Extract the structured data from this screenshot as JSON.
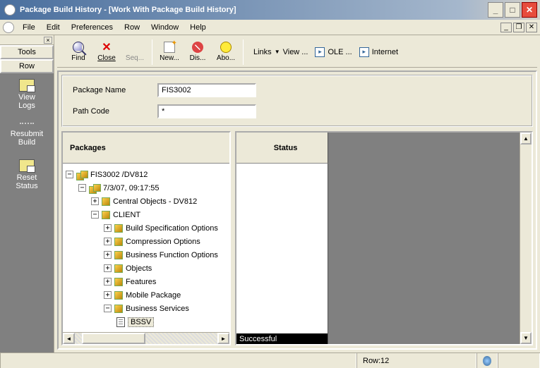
{
  "window": {
    "title": "Package Build History - [Work With Package Build History]"
  },
  "menus": [
    "File",
    "Edit",
    "Preferences",
    "Row",
    "Window",
    "Help"
  ],
  "toolbar": {
    "find": "Find",
    "close": "Close",
    "seq": "Seq...",
    "new": "New...",
    "dis": "Dis...",
    "abo": "Abo...",
    "links": "Links",
    "view": "View ...",
    "ole": "OLE ...",
    "internet": "Internet"
  },
  "sidebar": {
    "tab_tools": "Tools",
    "tab_row": "Row",
    "items": [
      {
        "label": "View\nLogs"
      },
      {
        "label": "Resubmit\nBuild"
      },
      {
        "label": "Reset\nStatus"
      }
    ]
  },
  "form": {
    "pkg_label": "Package Name",
    "pkg_value": "FIS3002",
    "path_label": "Path Code",
    "path_value": "*"
  },
  "panes": {
    "left_header": "Packages",
    "right_header": "Status",
    "status_value": "Successful"
  },
  "tree": {
    "root": "FIS3002 /DV812",
    "n1": "7/3/07, 09:17:55",
    "n2": "Central Objects - DV812",
    "n3": "CLIENT",
    "c1": "Build Specification Options",
    "c2": "Compression Options",
    "c3": "Business Function Options",
    "c4": "Objects",
    "c5": "Features",
    "c6": "Mobile Package",
    "c7": "Business Services",
    "leaf": "BSSV"
  },
  "status": {
    "row": "Row:12"
  }
}
